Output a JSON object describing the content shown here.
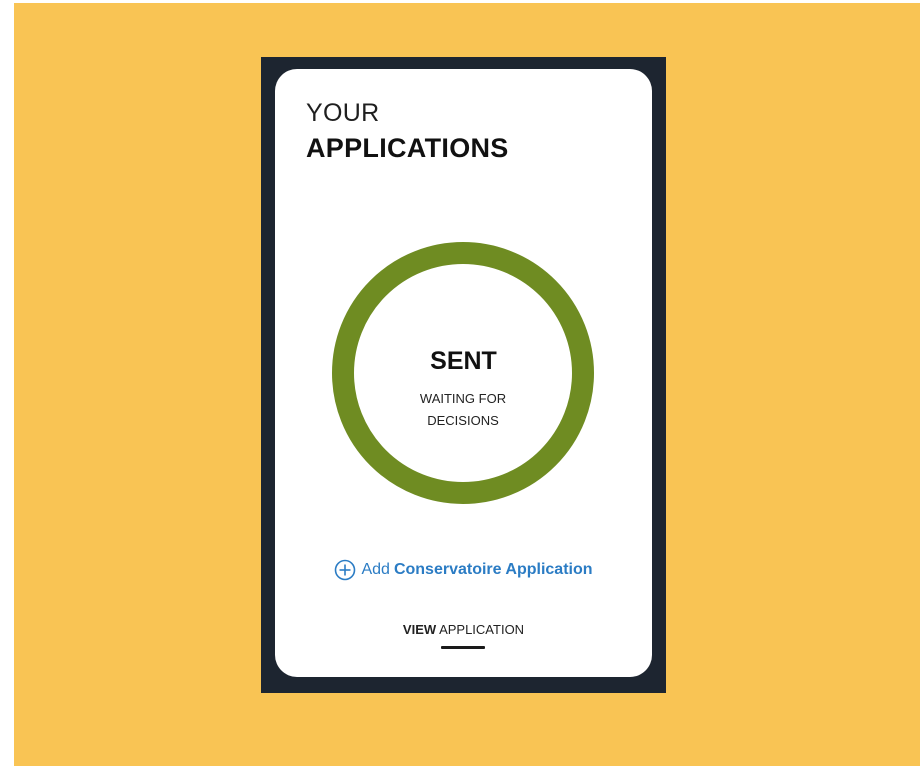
{
  "header": {
    "title_light": "YOUR",
    "title_bold": "APPLICATIONS"
  },
  "status": {
    "label": "SENT",
    "description": "WAITING FOR DECISIONS"
  },
  "add_application": {
    "prefix": "Add",
    "name": "Conservatoire Application",
    "icon": "plus-circle-icon"
  },
  "view_application": {
    "strong": "VIEW",
    "rest": "APPLICATION"
  },
  "colors": {
    "background": "#f9c454",
    "frame": "#1d2530",
    "ring": "#6f8c22",
    "link": "#2b7cc4"
  }
}
